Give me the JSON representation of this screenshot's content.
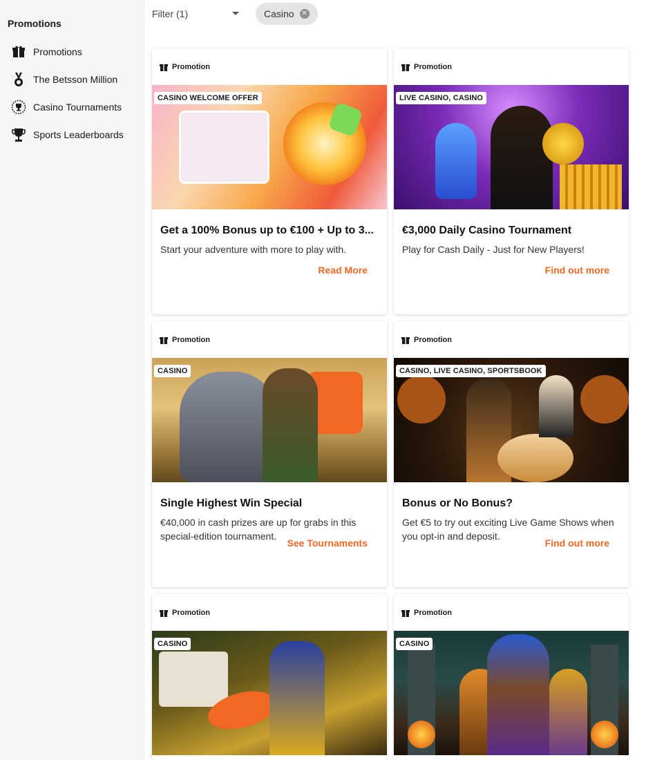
{
  "sidebar": {
    "title": "Promotions",
    "items": [
      {
        "label": "Promotions",
        "icon": "gift-icon"
      },
      {
        "label": "The Betsson Million",
        "icon": "medal-icon"
      },
      {
        "label": "Casino Tournaments",
        "icon": "trophy-badge-icon"
      },
      {
        "label": "Sports Leaderboards",
        "icon": "trophy-icon"
      }
    ]
  },
  "filter": {
    "label": "Filter (1)",
    "chip": "Casino"
  },
  "cards": [
    {
      "type": "Promotion",
      "tag": "CASINO WELCOME OFFER",
      "title": "Get a 100% Bonus up to €100 + Up to 3...",
      "desc": "Start your adventure with more to play with.",
      "cta": "Read More"
    },
    {
      "type": "Promotion",
      "tag": "LIVE CASINO, CASINO",
      "title": "€3,000 Daily Casino Tournament",
      "desc": "Play for Cash Daily - Just for New Players!",
      "cta": "Find out more"
    },
    {
      "type": "Promotion",
      "tag": "CASINO",
      "title": "Single Highest Win Special",
      "desc": "€40,000 in cash prizes are up for grabs in this special-edition tournament.",
      "cta": "See Tournaments"
    },
    {
      "type": "Promotion",
      "tag": "CASINO, LIVE CASINO, SPORTSBOOK",
      "title": "Bonus or No Bonus?",
      "desc": "Get €5 to try out exciting Live Game Shows when you opt-in and deposit.",
      "cta": "Find out more"
    },
    {
      "type": "Promotion",
      "tag": "CASINO"
    },
    {
      "type": "Promotion",
      "tag": "CASINO"
    }
  ],
  "colors": {
    "accent": "#f26722",
    "sidebar_bg": "#f5f5f5"
  }
}
